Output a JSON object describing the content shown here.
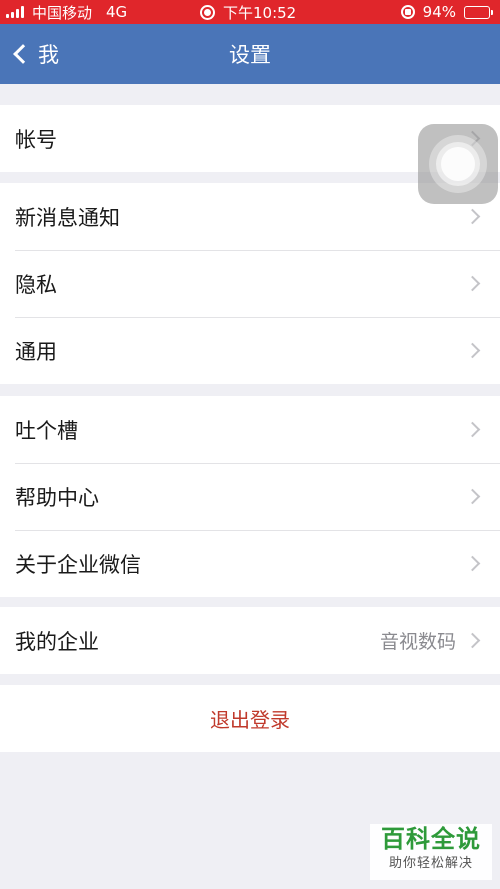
{
  "status_bar": {
    "carrier": "中国移动",
    "network": "4G",
    "time": "下午10:52",
    "battery": "94%",
    "battery_level": 0.94,
    "bar_color": "#e0262b"
  },
  "nav": {
    "back_label": "我",
    "title": "设置",
    "color": "#4a75b8"
  },
  "groups": {
    "account": {
      "item": "帐号"
    },
    "notify": {
      "items": [
        "新消息通知",
        "隐私",
        "通用"
      ]
    },
    "help": {
      "items": [
        "吐个槽",
        "帮助中心",
        "关于企业微信"
      ]
    },
    "enterprise": {
      "label": "我的企业",
      "value": "音视数码"
    }
  },
  "logout": {
    "label": "退出登录",
    "color": "#c0392b"
  },
  "watermark": {
    "title": "百科全说",
    "subtitle": "助你轻松解决"
  },
  "icons": [
    "signal-icon",
    "record-icon",
    "rotation-lock-icon",
    "battery-icon",
    "chevron-left-icon",
    "chevron-right-icon",
    "assistive-touch-icon"
  ]
}
